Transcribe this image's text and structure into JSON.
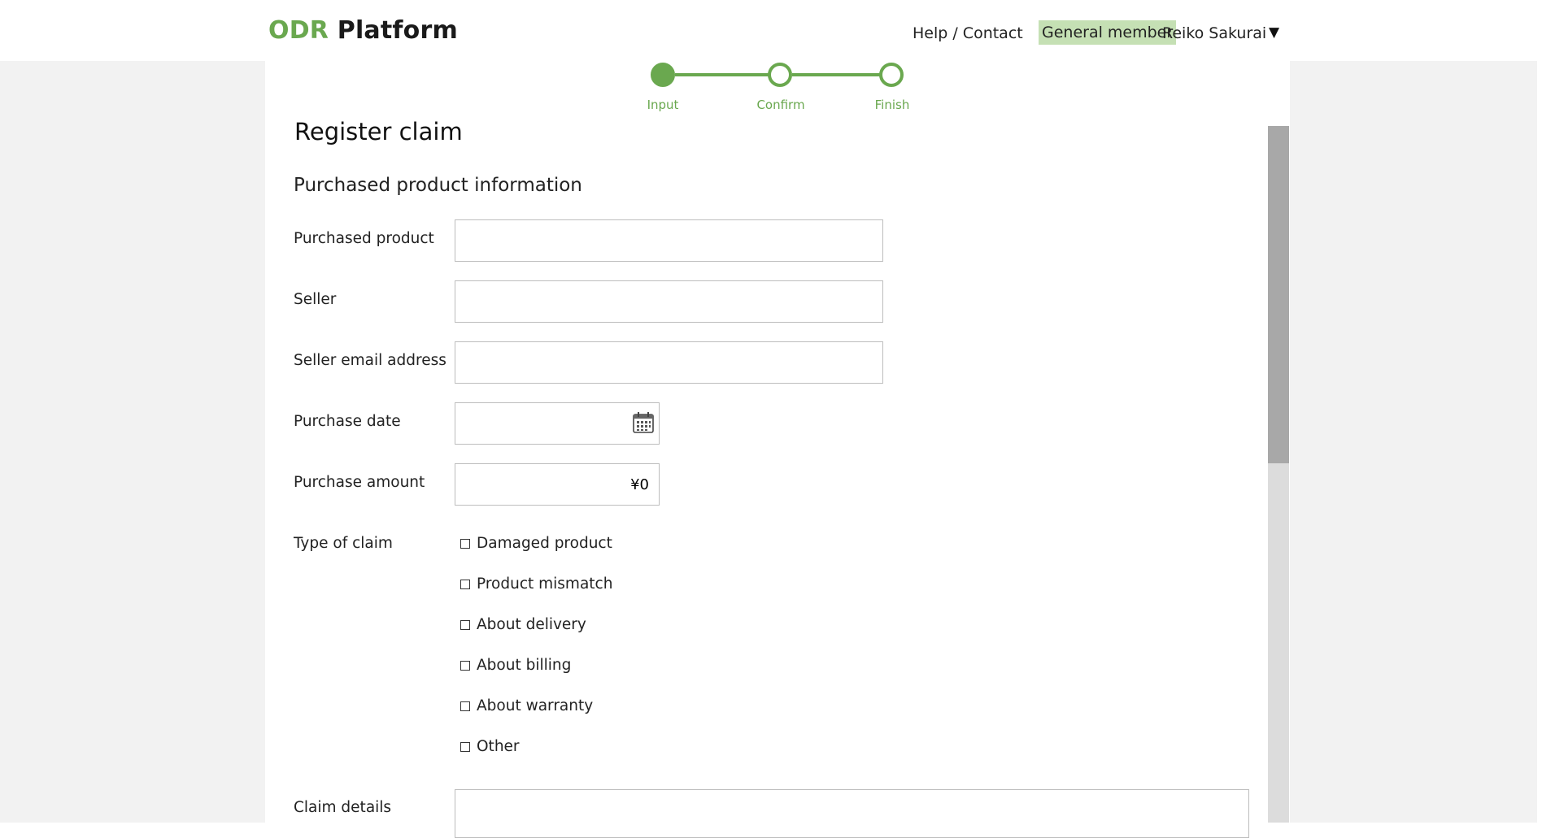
{
  "header": {
    "logo_accent": "ODR",
    "logo_rest": "Platform",
    "help_link": "Help / Contact",
    "member_badge": "General member",
    "user_name": "Reiko Sakurai",
    "user_caret": "▼"
  },
  "stepper": {
    "steps": [
      {
        "label": "Input",
        "state": "current"
      },
      {
        "label": "Confirm",
        "state": "upcoming"
      },
      {
        "label": "Finish",
        "state": "upcoming"
      }
    ],
    "accent_color": "#6aa84f"
  },
  "main": {
    "title": "Register claim",
    "section_title": "Purchased product information",
    "fields": {
      "purchased_product": {
        "label": "Purchased product",
        "value": ""
      },
      "seller": {
        "label": "Seller",
        "value": ""
      },
      "seller_email": {
        "label": "Seller email address",
        "value": ""
      },
      "purchase_date": {
        "label": "Purchase date",
        "value": "",
        "icon": "calendar-icon"
      },
      "purchase_amount": {
        "label": "Purchase amount",
        "value": "¥0"
      }
    },
    "claim_type": {
      "label": "Type of claim",
      "options": [
        {
          "label": "Damaged product",
          "checked": false
        },
        {
          "label": "Product mismatch",
          "checked": false
        },
        {
          "label": "About delivery",
          "checked": false
        },
        {
          "label": "About billing",
          "checked": false
        },
        {
          "label": "About warranty",
          "checked": false
        },
        {
          "label": "Other",
          "checked": false
        }
      ]
    },
    "claim_details": {
      "label": "Claim details",
      "value": ""
    }
  },
  "colors": {
    "badge_bg": "#c5e0b4",
    "page_bg": "#f2f2f2",
    "scroll_thumb": "#a8a8a8",
    "scroll_track": "#dcdcdc"
  }
}
